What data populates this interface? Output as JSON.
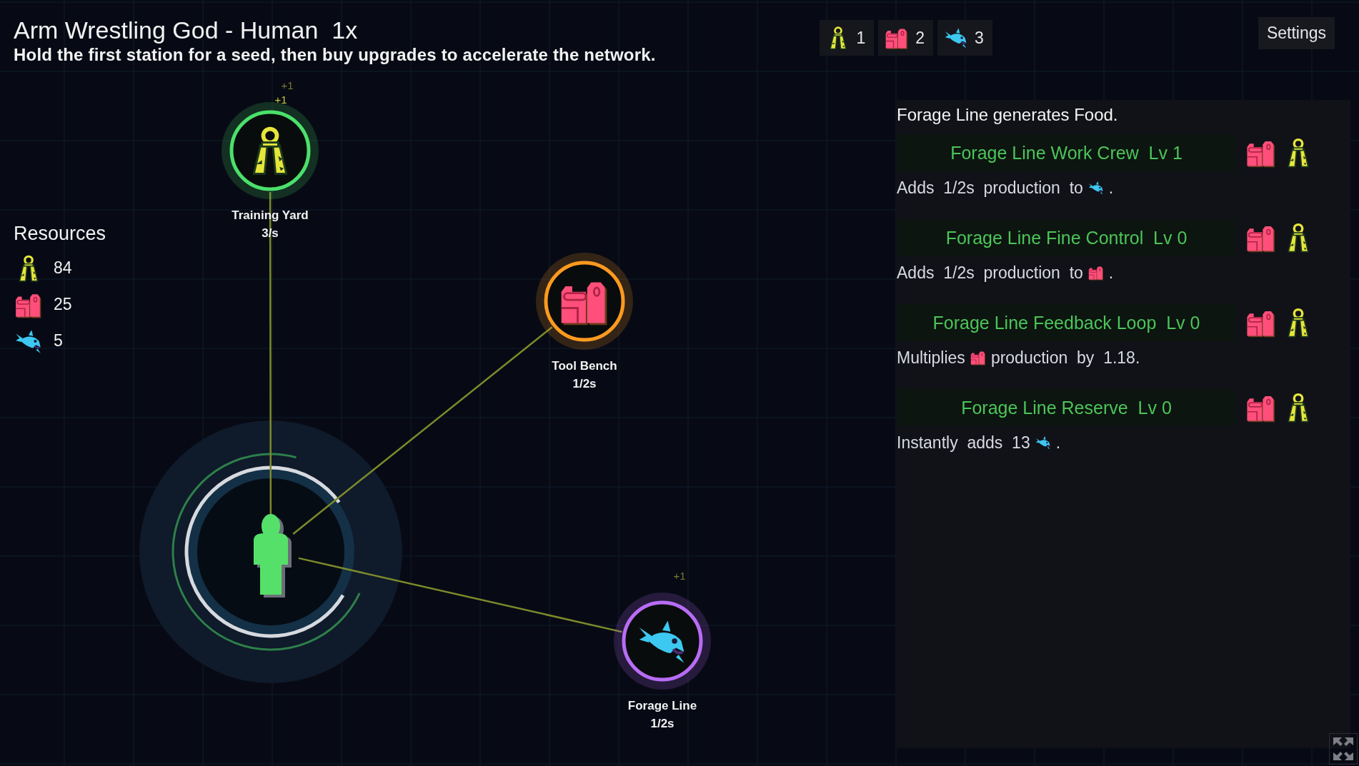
{
  "header": {
    "title": "Arm Wrestling God - Human",
    "speed": "1x",
    "subtitle": "Hold the first station for a seed, then buy upgrades to accelerate the network."
  },
  "resource_chips": [
    {
      "kind": "grip",
      "count": "1"
    },
    {
      "kind": "toolbox",
      "count": "2"
    },
    {
      "kind": "fish",
      "count": "3"
    }
  ],
  "settings_button": "Settings",
  "resources": {
    "heading": "Resources",
    "items": [
      {
        "kind": "grip",
        "amount": "84"
      },
      {
        "kind": "toolbox",
        "amount": "25"
      },
      {
        "kind": "fish",
        "amount": "5"
      }
    ]
  },
  "graph": {
    "stations": [
      {
        "name": "Training Yard",
        "rate": "3/s",
        "kind": "grip",
        "color": "#4be06a",
        "gains": [
          "+1",
          "+1"
        ]
      },
      {
        "name": "Tool Bench",
        "rate": "1/2s",
        "kind": "toolbox",
        "color": "#ff9a1f"
      },
      {
        "name": "Forage Line",
        "rate": "1/2s",
        "kind": "fish",
        "color": "#b86cf5",
        "gains": [
          "+1"
        ]
      }
    ]
  },
  "panel": {
    "description": "Forage Line generates Food.",
    "upgrades": [
      {
        "name": "Forage Line Work Crew",
        "level": "Lv 1",
        "cost": [
          {
            "kind": "toolbox"
          },
          {
            "kind": "grip"
          }
        ],
        "effect_before": "Adds  1/2s  production  to",
        "effect_icon": {
          "kind": "fish"
        },
        "effect_after": "."
      },
      {
        "name": "Forage Line Fine Control",
        "level": "Lv 0",
        "cost": [
          {
            "kind": "toolbox"
          },
          {
            "kind": "grip"
          }
        ],
        "effect_before": "Adds  1/2s  production  to",
        "effect_icon": {
          "kind": "toolbox"
        },
        "effect_after": "."
      },
      {
        "name": "Forage Line Feedback Loop",
        "level": "Lv 0",
        "cost": [
          {
            "kind": "toolbox"
          },
          {
            "kind": "grip"
          }
        ],
        "effect_before": "Multiplies",
        "effect_icon": {
          "kind": "toolbox"
        },
        "effect_after": "production  by  1.18."
      },
      {
        "name": "Forage Line Reserve",
        "level": "Lv 0",
        "cost": [
          {
            "kind": "toolbox"
          },
          {
            "kind": "grip"
          }
        ],
        "effect_before": "Instantly  adds  13",
        "effect_icon": {
          "kind": "fish"
        },
        "effect_after": "."
      }
    ]
  }
}
